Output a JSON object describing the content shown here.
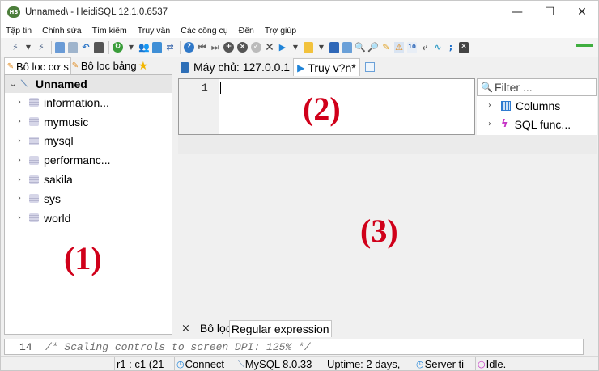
{
  "window": {
    "app_logo": "HS",
    "title": "Unnamed\\ - HeidiSQL 12.1.0.6537",
    "controls": {
      "minimize": "—",
      "maximize": "☐",
      "close": "✕"
    }
  },
  "menu": [
    "Tập tin",
    "Chỉnh sửa",
    "Tìm kiếm",
    "Truy vấn",
    "Các công cụ",
    "Đến",
    "Trợ giúp"
  ],
  "left_panel": {
    "tabs": [
      {
        "label": "Bô loc cơ s",
        "icon": "filter-icon"
      },
      {
        "label": "Bô loc bảng",
        "icon": "filter-icon"
      }
    ],
    "star": "★",
    "session_name": "Unnamed",
    "databases": [
      "information...",
      "mymusic",
      "mysql",
      "performanc...",
      "sakila",
      "sys",
      "world"
    ]
  },
  "query_tabs": {
    "host_tab": "Máy chủ: 127.0.0.1",
    "query_tab": "Truy v?n*"
  },
  "editor": {
    "line_number": "1",
    "content": ""
  },
  "helpers": {
    "filter_placeholder": "Filter ...",
    "items": [
      "Columns",
      "SQL func..."
    ]
  },
  "bottom_tabs": {
    "close": "×",
    "tab1": "Bô lọc",
    "tab2": "Regular expression"
  },
  "log": {
    "line_number": "14",
    "text": "/* Scaling controls to screen DPI: 125% */"
  },
  "status": {
    "position": "r1 : c1 (21",
    "connected": "Connect",
    "server_version": "MySQL 8.0.33",
    "uptime": "Uptime: 2 days,",
    "server_time": "Server ti",
    "state": "Idle."
  },
  "annotations": {
    "left": "(1)",
    "editor": "(2)",
    "results": "(3)"
  },
  "colors": {
    "annotation": "#d0001a",
    "accent_blue": "#1f84d8",
    "tree_selected": "#e6e6e6"
  }
}
